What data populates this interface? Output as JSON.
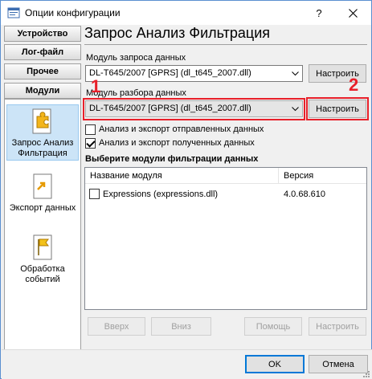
{
  "window": {
    "title": "Опции конфигурации",
    "help_glyph": "?",
    "close_glyph": "✕"
  },
  "sidebar": {
    "tabs": [
      {
        "label": "Устройство"
      },
      {
        "label": "Лог-файл"
      },
      {
        "label": "Прочее"
      },
      {
        "label": "Модули"
      }
    ],
    "items": [
      {
        "label": "Запрос Анализ Фильтрация",
        "icon": "puzzle-icon",
        "selected": true
      },
      {
        "label": "Экспорт данных",
        "icon": "export-icon",
        "selected": false
      },
      {
        "label": "Обработка событий",
        "icon": "flag-icon",
        "selected": false
      }
    ]
  },
  "main": {
    "heading": "Запрос Анализ Фильтрация",
    "query_module": {
      "label": "Модуль запроса данных",
      "value": "DL-T645/2007 [GPRS] (dl_t645_2007.dll)",
      "configure_label": "Настроить"
    },
    "parse_module": {
      "label": "Модуль разбора данных",
      "value": "DL-T645/2007 [GPRS] (dl_t645_2007.dll)",
      "configure_label": "Настроить"
    },
    "checkboxes": [
      {
        "label": "Анализ и экспорт отправленных данных",
        "checked": false
      },
      {
        "label": "Анализ и экспорт полученных данных",
        "checked": true
      }
    ],
    "filter_section": {
      "title": "Выберите модули фильтрации данных",
      "columns": [
        "Название модуля",
        "Версия"
      ],
      "rows": [
        {
          "name": "Expressions (expressions.dll)",
          "version": "4.0.68.610",
          "checked": false
        }
      ]
    },
    "buttons": {
      "up": "Вверх",
      "down": "Вниз",
      "help": "Помощь",
      "configure": "Настроить"
    }
  },
  "footer": {
    "ok": "OK",
    "cancel": "Отмена"
  },
  "annotations": {
    "marker_1": "1",
    "marker_2": "2",
    "color": "#e8202a"
  }
}
